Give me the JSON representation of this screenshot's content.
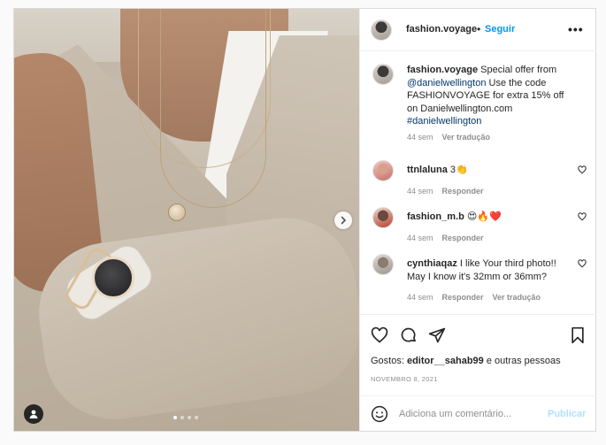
{
  "colors": {
    "accent": "#0095f6",
    "text": "#262626",
    "muted": "#8e8e8e",
    "link": "#00376b",
    "disabled_accent": "#b2dffc"
  },
  "photo": {
    "slides_total": 4,
    "active_slide": 1,
    "next_icon": "chevron-right-icon",
    "tag_icon": "user-tag-icon"
  },
  "header": {
    "username": "fashion.voyage",
    "separator": "•",
    "follow_label": "Seguir",
    "more_icon": "more-horizontal-icon"
  },
  "caption": {
    "username": "fashion.voyage",
    "text_1": " Special offer from ",
    "mention": "@danielwellington",
    "text_2": " Use the code FASHIONVOYAGE for extra 15% off on Danielwellington.com ",
    "hashtag": "#danielwellington",
    "time": "44 sem",
    "translate": "Ver tradução"
  },
  "comments": [
    {
      "username": "ttnlaluna",
      "text": " 3👏",
      "time": "44 sem",
      "reply": "Responder"
    },
    {
      "username": "fashion_m.b",
      "text": " 😍🔥❤️",
      "time": "44 sem",
      "reply": "Responder"
    },
    {
      "username": "cynthiaqaz",
      "text": " I like Your third photo!! May I know it's 32mm or 36mm?",
      "time": "44 sem",
      "reply": "Responder",
      "translate": "Ver tradução"
    }
  ],
  "actions": {
    "like_icon": "heart-icon",
    "comment_icon": "comment-icon",
    "share_icon": "share-icon",
    "save_icon": "bookmark-icon"
  },
  "likes": {
    "prefix": "Gostos: ",
    "user": "editor__sahab99",
    "suffix": " e outras pessoas"
  },
  "date": "NOVEMBRO 8, 2021",
  "composer": {
    "emoji_icon": "smile-icon",
    "placeholder": "Adiciona um comentário...",
    "post_label": "Publicar"
  }
}
